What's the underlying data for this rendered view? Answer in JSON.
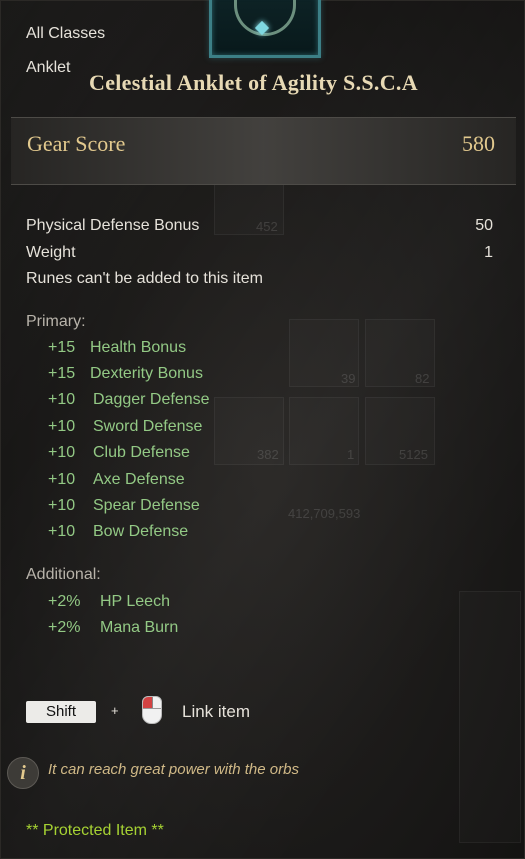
{
  "item": {
    "class_restriction": "All Classes",
    "type": "Anklet",
    "name": "Celestial Anklet of Agility S.S.C.A"
  },
  "gear_score": {
    "label": "Gear Score",
    "value": "580"
  },
  "stats": [
    {
      "label": "Physical Defense Bonus",
      "value": "50"
    },
    {
      "label": "Weight",
      "value": "1"
    }
  ],
  "runes_note": "Runes can't be added to this item",
  "primary": {
    "heading": "Primary:",
    "rows": [
      {
        "value": "+15",
        "label": "Health Bonus"
      },
      {
        "value": "+15",
        "label": "Dexterity Bonus"
      },
      {
        "value": "+10",
        "label": "Dagger Defense"
      },
      {
        "value": "+10",
        "label": "Sword Defense"
      },
      {
        "value": "+10",
        "label": "Club Defense"
      },
      {
        "value": "+10",
        "label": "Axe Defense"
      },
      {
        "value": "+10",
        "label": "Spear Defense"
      },
      {
        "value": "+10",
        "label": "Bow Defense"
      }
    ]
  },
  "additional": {
    "heading": "Additional:",
    "rows": [
      {
        "value": "+2%",
        "label": "HP Leech"
      },
      {
        "value": "+2%",
        "label": "Mana Burn"
      }
    ]
  },
  "link_hint": {
    "key": "Shift",
    "plus": "+",
    "mouse_icon": "mouse-left-click-icon",
    "label": "Link item"
  },
  "info": {
    "icon": "info-icon",
    "text": "It can reach great power with the orbs"
  },
  "protected": "** Protected Item **",
  "background_ghost_numbers": [
    "452",
    "39",
    "82",
    "382",
    "1",
    "5125",
    "412,709,593"
  ],
  "colors": {
    "accent_gold": "#e2c98e",
    "stat_green": "#93c985",
    "protected_green": "#a6d233",
    "frame_teal": "#3c7f86"
  }
}
